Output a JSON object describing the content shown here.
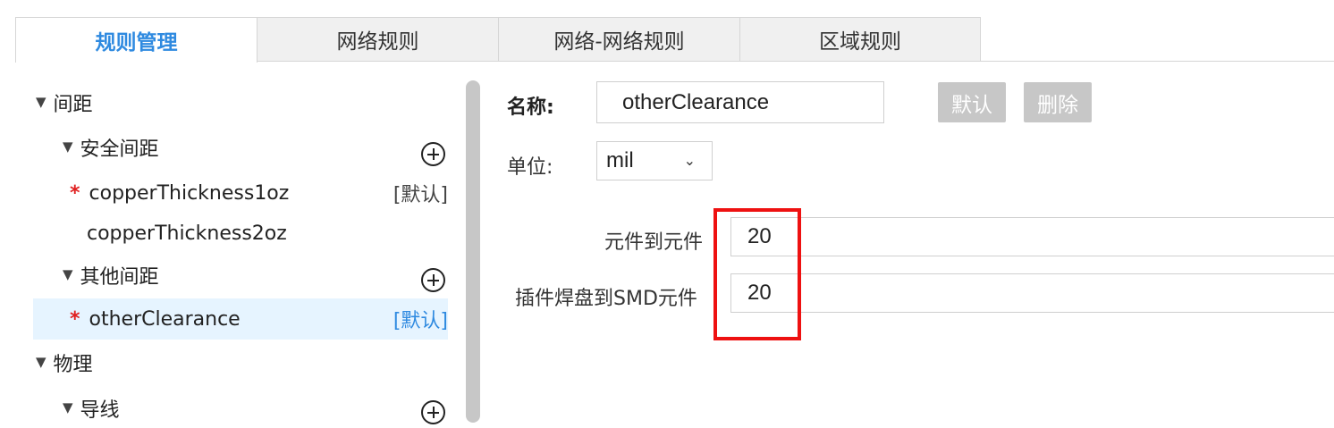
{
  "tabs": [
    "规则管理",
    "网络规则",
    "网络-网络规则",
    "区域规则"
  ],
  "active_tab": 0,
  "tree": {
    "spacing": "间距",
    "safety_spacing": "安全间距",
    "item1": "copperThickness1oz",
    "item1_tag": "[默认]",
    "item2": "copperThickness2oz",
    "other_spacing": "其他间距",
    "item3": "otherClearance",
    "item3_tag": "[默认]",
    "physical": "物理",
    "wire": "导线",
    "required_mark": "*"
  },
  "form": {
    "name_label": "名称:",
    "name_value": "otherClearance",
    "default_button": "默认",
    "delete_button": "删除",
    "unit_label": "单位:",
    "unit_value": "mil",
    "comp_to_comp_label": "元件到元件",
    "comp_to_comp_value": "20",
    "tht_to_smd_label": "插件焊盘到SMD元件",
    "tht_to_smd_value": "20"
  },
  "colors": {
    "accent": "#2f8ae0",
    "required": "#e02020",
    "highlight": "#ee1111",
    "selected_row": "#e6f4ff"
  }
}
